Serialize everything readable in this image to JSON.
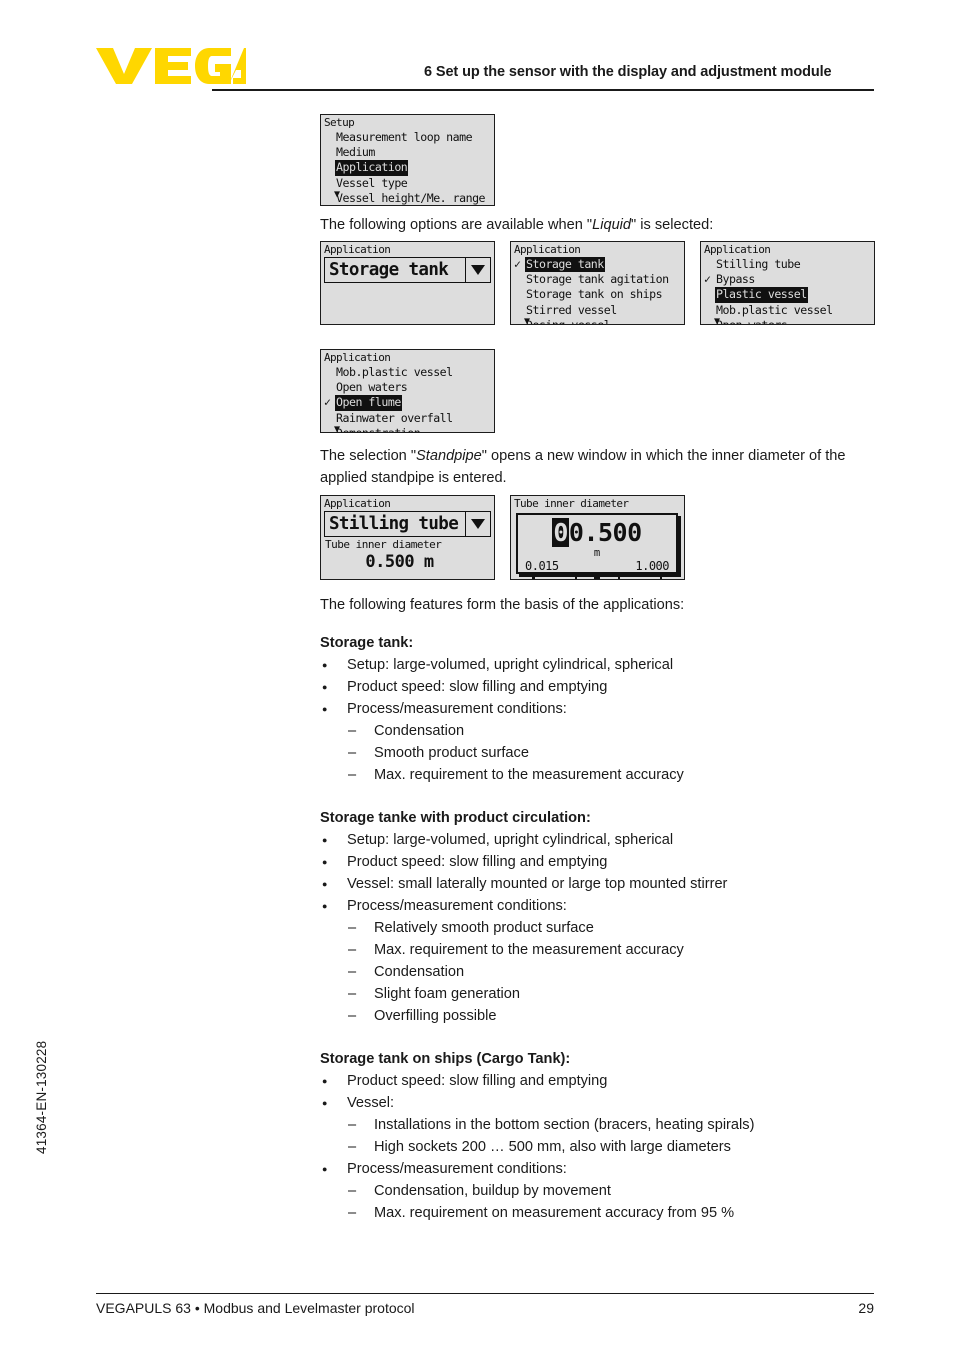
{
  "header": {
    "logo_text": "VEGA",
    "logo_color": "#FFD700",
    "title": "6 Set up the sensor with the display and adjustment module"
  },
  "doc_code": "41364-EN-130228",
  "footer": {
    "left": "VEGAPULS 63 • Modbus and Levelmaster protocol",
    "page": "29"
  },
  "paragraphs": {
    "liquid_intro_a": "The following options are available when \"",
    "liquid_intro_em": "Liquid",
    "liquid_intro_b": "\" is selected:",
    "standpipe_a": "The selection \"",
    "standpipe_em": "Standpipe",
    "standpipe_b": "\" opens a new window in which the inner diameter of the applied standpipe is entered.",
    "features_intro": "The following features form the basis of the applications:"
  },
  "lcd": {
    "setup_menu": {
      "title": "Setup",
      "items": [
        {
          "label": "Measurement loop name",
          "selected": false,
          "check": false
        },
        {
          "label": "Medium",
          "selected": false,
          "check": false
        },
        {
          "label": "Application",
          "selected": true,
          "check": false
        },
        {
          "label": "Vessel type",
          "selected": false,
          "check": false
        },
        {
          "label": "Vessel height/Me. range",
          "selected": false,
          "check": false
        }
      ],
      "more_indicator": "▼"
    },
    "application_dropdown": {
      "title": "Application",
      "value": "Storage tank",
      "caret": "chevron-down-icon"
    },
    "application_list_1": {
      "title": "Application",
      "items": [
        {
          "label": "Storage tank",
          "selected": true,
          "check": true
        },
        {
          "label": "Storage tank agitation",
          "selected": false,
          "check": false
        },
        {
          "label": "Storage tank on ships",
          "selected": false,
          "check": false
        },
        {
          "label": "Stirred vessel",
          "selected": false,
          "check": false
        },
        {
          "label": "Dosing vessel",
          "selected": false,
          "check": false
        }
      ],
      "more_indicator": "▼"
    },
    "application_list_2": {
      "title": "Application",
      "items": [
        {
          "label": "Stilling tube",
          "selected": false,
          "check": false
        },
        {
          "label": "Bypass",
          "selected": false,
          "check": true
        },
        {
          "label": "Plastic vessel",
          "selected": true,
          "check": false
        },
        {
          "label": "Mob.plastic vessel",
          "selected": false,
          "check": false
        },
        {
          "label": "Open waters",
          "selected": false,
          "check": false
        }
      ],
      "more_indicator": "▼"
    },
    "application_list_3": {
      "title": "Application",
      "items": [
        {
          "label": "Mob.plastic vessel",
          "selected": false,
          "check": false
        },
        {
          "label": "Open waters",
          "selected": false,
          "check": false
        },
        {
          "label": "Open flume",
          "selected": true,
          "check": true
        },
        {
          "label": "Rainwater overfall",
          "selected": false,
          "check": false
        },
        {
          "label": "Demonstration",
          "selected": false,
          "check": false
        }
      ],
      "more_indicator": "▼"
    },
    "stilling_tube": {
      "title": "Application",
      "value": "Stilling tube",
      "sub_label": "Tube inner diameter",
      "sub_value": "0.500 m"
    },
    "tube_editor": {
      "title": "Tube inner diameter",
      "cursor_digit": "0",
      "rest_digits": "0.500",
      "unit": "m",
      "range_min": "0.015",
      "range_max": "1.000"
    }
  },
  "sections": [
    {
      "heading": "Storage tank:",
      "items": [
        {
          "type": "bullet",
          "text": "Setup: large-volumed, upright cylindrical, spherical"
        },
        {
          "type": "bullet",
          "text": "Product speed: slow filling and emptying"
        },
        {
          "type": "bullet",
          "text": "Process/measurement conditions:"
        },
        {
          "type": "dash",
          "text": "Condensation"
        },
        {
          "type": "dash",
          "text": "Smooth product surface"
        },
        {
          "type": "dash",
          "text": "Max. requirement to the measurement accuracy"
        }
      ]
    },
    {
      "heading": "Storage tanke with product circulation:",
      "items": [
        {
          "type": "bullet",
          "text": "Setup: large-volumed, upright cylindrical, spherical"
        },
        {
          "type": "bullet",
          "text": "Product speed: slow filling and emptying"
        },
        {
          "type": "bullet",
          "text": "Vessel: small laterally mounted or large top mounted stirrer"
        },
        {
          "type": "bullet",
          "text": "Process/measurement conditions:"
        },
        {
          "type": "dash",
          "text": "Relatively smooth product surface"
        },
        {
          "type": "dash",
          "text": "Max. requirement to the measurement accuracy"
        },
        {
          "type": "dash",
          "text": "Condensation"
        },
        {
          "type": "dash",
          "text": "Slight foam generation"
        },
        {
          "type": "dash",
          "text": "Overfilling possible"
        }
      ]
    },
    {
      "heading": "Storage tank on ships (Cargo Tank):",
      "items": [
        {
          "type": "bullet",
          "text": "Product speed: slow filling and emptying"
        },
        {
          "type": "bullet",
          "text": "Vessel:"
        },
        {
          "type": "dash",
          "text": "Installations in the bottom section (bracers, heating spirals)"
        },
        {
          "type": "dash",
          "text": "High sockets 200 … 500 mm, also with large diameters"
        },
        {
          "type": "bullet",
          "text": "Process/measurement conditions:"
        },
        {
          "type": "dash",
          "text": "Condensation, buildup by movement"
        },
        {
          "type": "dash",
          "text": "Max. requirement on measurement accuracy from 95 %"
        }
      ]
    }
  ]
}
